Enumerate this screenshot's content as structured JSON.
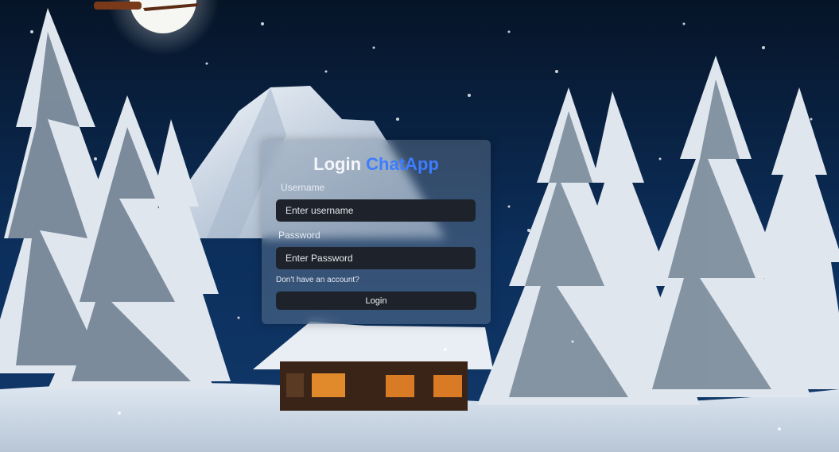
{
  "login": {
    "title_word": "Login",
    "brand": "ChatApp",
    "username_label": "Username",
    "username_placeholder": "Enter username",
    "password_label": "Password",
    "password_placeholder": "Enter Password",
    "signup_link": "Don't have an account?",
    "submit_label": "Login"
  },
  "colors": {
    "accent": "#3d7dff",
    "input_bg": "#1d222b",
    "sky": "#0b2a55"
  }
}
